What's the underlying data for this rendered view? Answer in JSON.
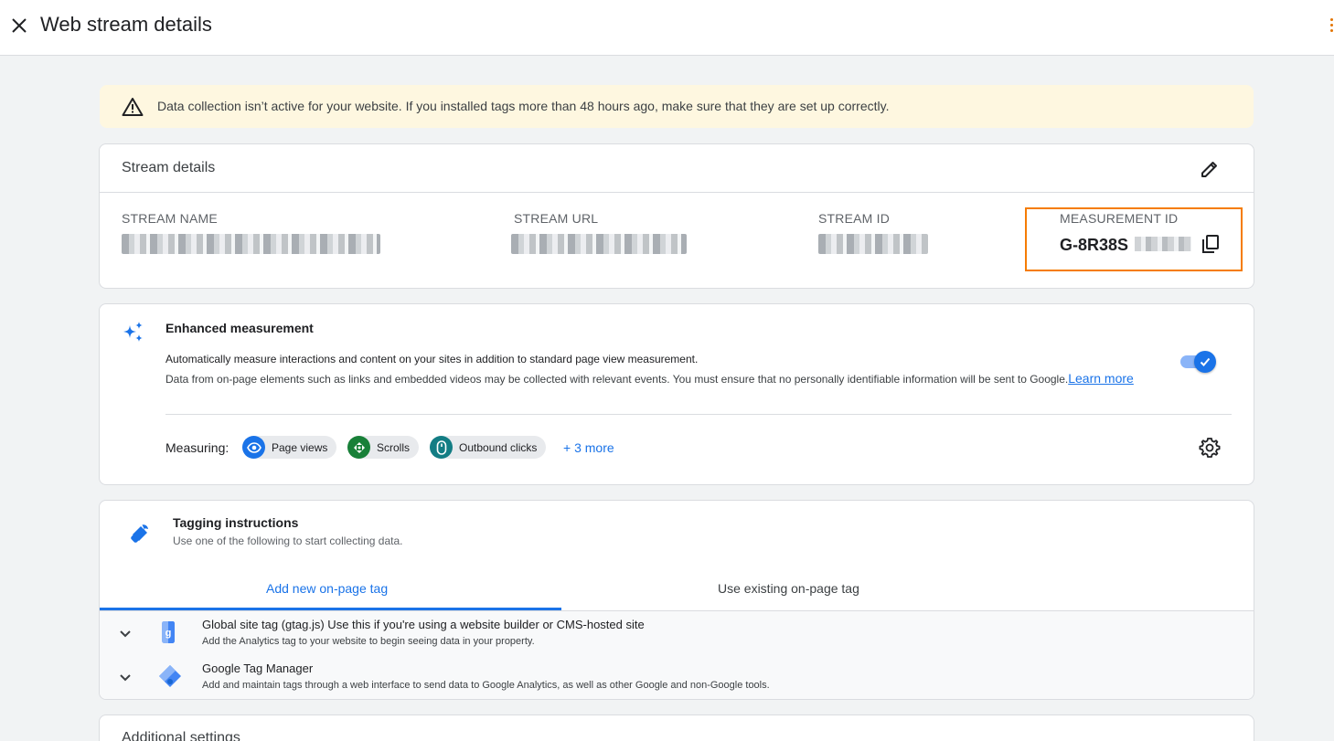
{
  "header": {
    "title": "Web stream details"
  },
  "alert": {
    "text": "Data collection isn’t active for your website. If you installed tags more than 48 hours ago, make sure that they are set up correctly."
  },
  "stream_details": {
    "title": "Stream details",
    "fields": {
      "name_label": "STREAM NAME",
      "url_label": "STREAM URL",
      "id_label": "STREAM ID",
      "measurement_label": "MEASUREMENT ID",
      "measurement_value": "G-8R38S"
    }
  },
  "enhanced": {
    "title": "Enhanced measurement",
    "description_primary": "Automatically measure interactions and content on your sites in addition to standard page view measurement.",
    "description_secondary": "Data from on-page elements such as links and embedded videos may be collected with relevant events. You must ensure that no personally identifiable information will be sent to Google.",
    "learn_more": "Learn more",
    "toggle_on": true,
    "measuring_label": "Measuring:",
    "chips": [
      "Page views",
      "Scrolls",
      "Outbound clicks"
    ],
    "more": "+ 3 more"
  },
  "tagging": {
    "title": "Tagging instructions",
    "subtitle": "Use one of the following to start collecting data.",
    "tabs": [
      "Add new on-page tag",
      "Use existing on-page tag"
    ],
    "options": [
      {
        "name": "Global site tag (gtag.js)",
        "suffix": " Use this if you're using a website builder or CMS-hosted site",
        "description": "Add the Analytics tag to your website to begin seeing data in your property."
      },
      {
        "name": "Google Tag Manager",
        "suffix": "",
        "description": "Add and maintain tags through a web interface to send data to Google Analytics, as well as other Google and non-Google tools."
      }
    ]
  },
  "additional": {
    "title": "Additional settings"
  },
  "colors": {
    "accent": "#1a73e8",
    "highlight": "#f57c00",
    "alert_bg": "#fef7e0",
    "green": "#188038",
    "teal": "#137d84"
  },
  "icons": [
    "close-icon",
    "warning-icon",
    "edit-icon",
    "copy-icon",
    "sparkle-icon",
    "check-icon",
    "eye-icon",
    "scroll-icon",
    "mouse-icon",
    "gear-icon",
    "wrench-icon",
    "chevron-down-icon",
    "gtag-icon",
    "gtm-icon",
    "more-vert-icon"
  ]
}
